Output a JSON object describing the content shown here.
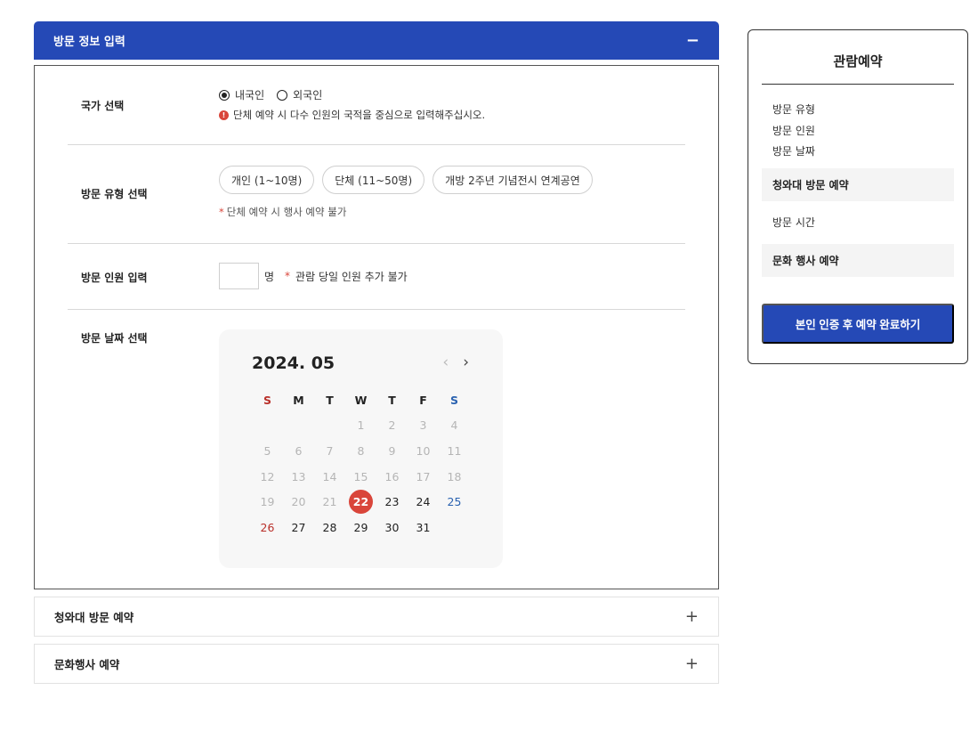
{
  "visit_info": {
    "header_title": "방문 정보 입력",
    "collapse_symbol": "−",
    "country": {
      "label": "국가 선택",
      "options": [
        "내국인",
        "외국인"
      ],
      "selected": "내국인",
      "notice": "단체 예약 시 다수 인원의 국적을 중심으로 입력해주십시오."
    },
    "visit_type": {
      "label": "방문 유형 선택",
      "chips": [
        "개인 (1~10명)",
        "단체 (11~50명)",
        "개방 2주년 기념전시 연계공연"
      ],
      "note_star": "*",
      "note": "단체 예약 시 행사 예약 불가"
    },
    "visitor_count": {
      "label": "방문 인원 입력",
      "value": "",
      "unit": "명",
      "note_star": "*",
      "note": "관람 당일 인원 추가 불가"
    },
    "visit_date": {
      "label": "방문 날짜 선택",
      "calendar_title": "2024. 05",
      "prev_symbol": "‹",
      "next_symbol": "›",
      "weekdays": [
        "S",
        "M",
        "T",
        "W",
        "T",
        "F",
        "S"
      ],
      "selected_day": "22",
      "weeks": [
        [
          "",
          "",
          "",
          "1",
          "2",
          "3",
          "4"
        ],
        [
          "5",
          "6",
          "7",
          "8",
          "9",
          "10",
          "11"
        ],
        [
          "12",
          "13",
          "14",
          "15",
          "16",
          "17",
          "18"
        ],
        [
          "19",
          "20",
          "21",
          "22",
          "23",
          "24",
          "25"
        ],
        [
          "26",
          "27",
          "28",
          "29",
          "30",
          "31",
          ""
        ]
      ]
    }
  },
  "collapsed_sections": [
    {
      "title": "청와대 방문 예약",
      "symbol": "+"
    },
    {
      "title": "문화행사 예약",
      "symbol": "+"
    }
  ],
  "summary": {
    "title": "관람예약",
    "items": [
      "방문 유형",
      "방문 인원",
      "방문 날짜"
    ],
    "band1": "청와대 방문 예약",
    "plain1": "방문 시간",
    "band2": "문화 행사 예약",
    "button": "본인 인증 후 예약 완료하기"
  },
  "colors": {
    "primary": "#2549b6",
    "accent_red": "#d9453a",
    "saturday_blue": "#2a62b0",
    "sunday_red": "#b9302a"
  }
}
